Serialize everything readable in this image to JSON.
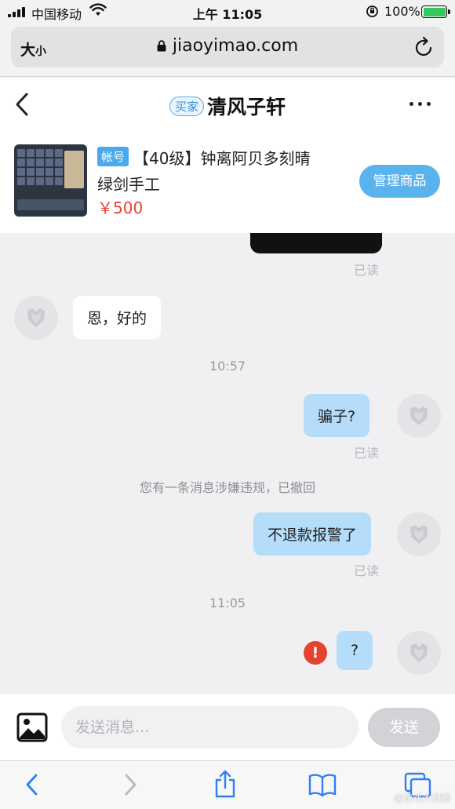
{
  "status_bar": {
    "carrier": "中国移动",
    "time": "上午 11:05",
    "battery_percent": "100%",
    "battery_level": 1.0
  },
  "browser": {
    "text_size_label": "大",
    "text_size_label_small": "小",
    "url": "jiaoyimao.com"
  },
  "header": {
    "role_badge": "买家",
    "contact_name": "清风子轩"
  },
  "product": {
    "type_badge": "帐号",
    "title_line1": "【40级】钟离阿贝多刻晴",
    "title_line2": "绿剑手工",
    "price": "￥500",
    "manage_label": "管理商品"
  },
  "messages": {
    "read_label": "已读",
    "in_1": "恩，好的",
    "time_1": "10:57",
    "out_1": "骗子?",
    "system_note": "您有一条消息涉嫌违规，已撤回",
    "out_2": "不退款报警了",
    "time_2": "11:05",
    "out_3": "?",
    "out_3_status": "!"
  },
  "input": {
    "placeholder": "发送消息...",
    "send_label": "发送"
  },
  "watermark": "@游戏大观园"
}
